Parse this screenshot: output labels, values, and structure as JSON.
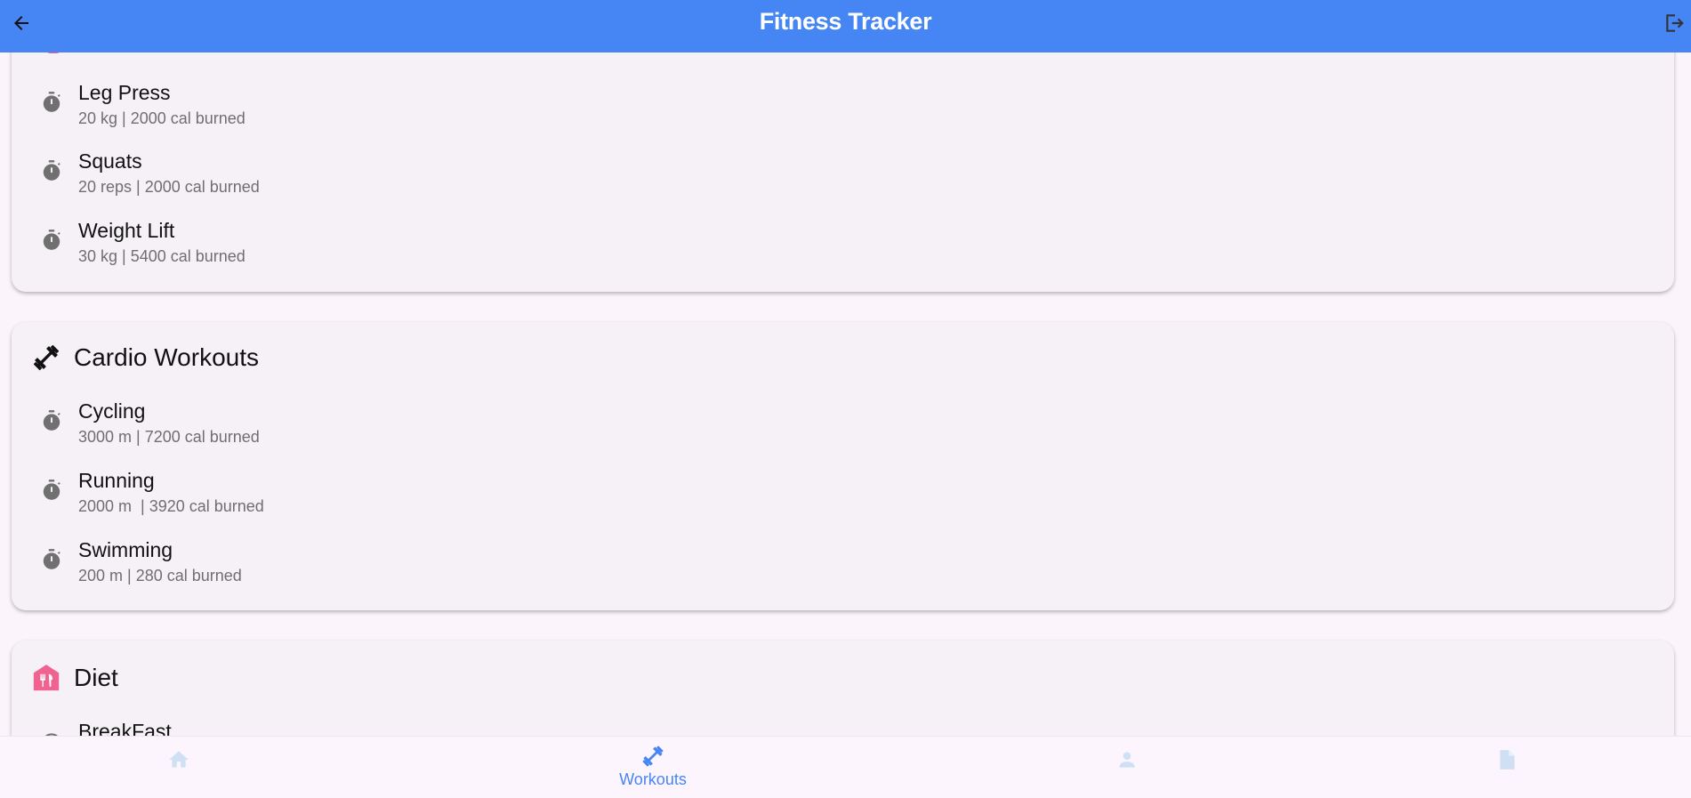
{
  "app": {
    "title": "Fitness Tracker",
    "accent_color": "#4686f4"
  },
  "appbar": {
    "back_icon": "arrow-left-icon",
    "logout_icon": "logout-icon"
  },
  "strength_card": {
    "items": [
      {
        "name": "Leg Press",
        "detail": "20 kg | 2000 cal burned",
        "icon": "timer-icon"
      },
      {
        "name": "Squats",
        "detail": "20 reps | 2000 cal burned",
        "icon": "timer-icon"
      },
      {
        "name": "Weight Lift",
        "detail": "30 kg | 5400 cal burned",
        "icon": "timer-icon"
      }
    ]
  },
  "cardio_card": {
    "title": "Cardio Workouts",
    "icon": "fitness-dumbbell-icon",
    "items": [
      {
        "name": "Cycling",
        "detail": "3000 m | 7200 cal burned",
        "icon": "timer-icon"
      },
      {
        "name": "Running",
        "detail": "2000 m  | 3920 cal burned",
        "icon": "timer-icon"
      },
      {
        "name": "Swimming",
        "detail": "200 m | 280 cal burned",
        "icon": "timer-icon"
      }
    ]
  },
  "diet_card": {
    "title": "Diet",
    "icon": "restaurant-icon",
    "icon_color": "#f0628f",
    "items": [
      {
        "name": "BreakFast",
        "icon": "clock-icon"
      }
    ]
  },
  "bottom_nav": {
    "items": [
      {
        "id": "home",
        "icon": "home-icon",
        "label": ""
      },
      {
        "id": "workouts",
        "icon": "fitness-dumbbell-icon",
        "label": "Workouts",
        "active": true
      },
      {
        "id": "profile",
        "icon": "person-icon",
        "label": ""
      },
      {
        "id": "reports",
        "icon": "document-icon",
        "label": ""
      }
    ]
  }
}
